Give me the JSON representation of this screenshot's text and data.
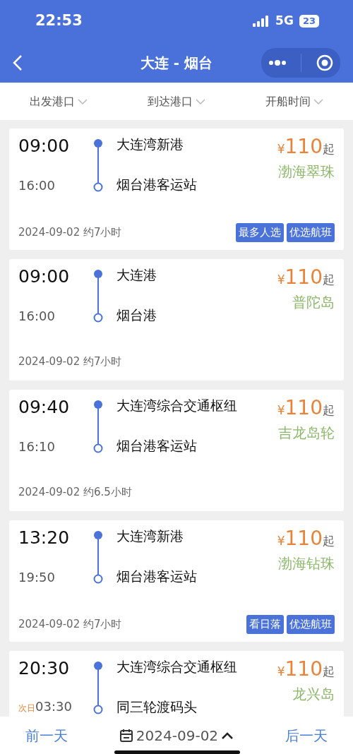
{
  "status_bar": {
    "time": "22:53",
    "network": "5G",
    "battery": "23"
  },
  "nav": {
    "title": "大连 - 烟台"
  },
  "filters": [
    {
      "label": "出发港口"
    },
    {
      "label": "到达港口"
    },
    {
      "label": "开船时间"
    }
  ],
  "sailings": [
    {
      "depart_time": "09:00",
      "arrive_time": "16:00",
      "from": "大连湾新港",
      "to": "烟台港客运站",
      "currency": "¥",
      "price": "110",
      "price_suffix": "起",
      "ship": "渤海翠珠",
      "date": "2024-09-02",
      "duration": "约7小时",
      "tags": [
        "最多人选",
        "优选航班"
      ]
    },
    {
      "depart_time": "09:00",
      "arrive_time": "16:00",
      "from": "大连港",
      "to": "烟台港",
      "currency": "¥",
      "price": "110",
      "price_suffix": "起",
      "ship": "普陀岛",
      "date": "2024-09-02",
      "duration": "约7小时"
    },
    {
      "depart_time": "09:40",
      "arrive_time": "16:10",
      "from": "大连湾综合交通枢纽",
      "to": "烟台港客运站",
      "currency": "¥",
      "price": "110",
      "price_suffix": "起",
      "ship": "吉龙岛轮",
      "date": "2024-09-02",
      "duration": "约6.5小时"
    },
    {
      "depart_time": "13:20",
      "arrive_time": "19:50",
      "from": "大连湾新港",
      "to": "烟台港客运站",
      "currency": "¥",
      "price": "110",
      "price_suffix": "起",
      "ship": "渤海钻珠",
      "date": "2024-09-02",
      "duration": "约7小时",
      "tags": [
        "看日落",
        "优选航班"
      ]
    },
    {
      "depart_time": "20:30",
      "arrive_note": "次日",
      "arrive_time": "03:30",
      "from": "大连湾综合交通枢纽",
      "to": "同三轮渡码头",
      "currency": "¥",
      "price": "110",
      "price_suffix": "起",
      "ship": "龙兴岛"
    }
  ],
  "bottom_bar": {
    "prev": "前一天",
    "date": "2024-09-02",
    "next": "后一天"
  }
}
